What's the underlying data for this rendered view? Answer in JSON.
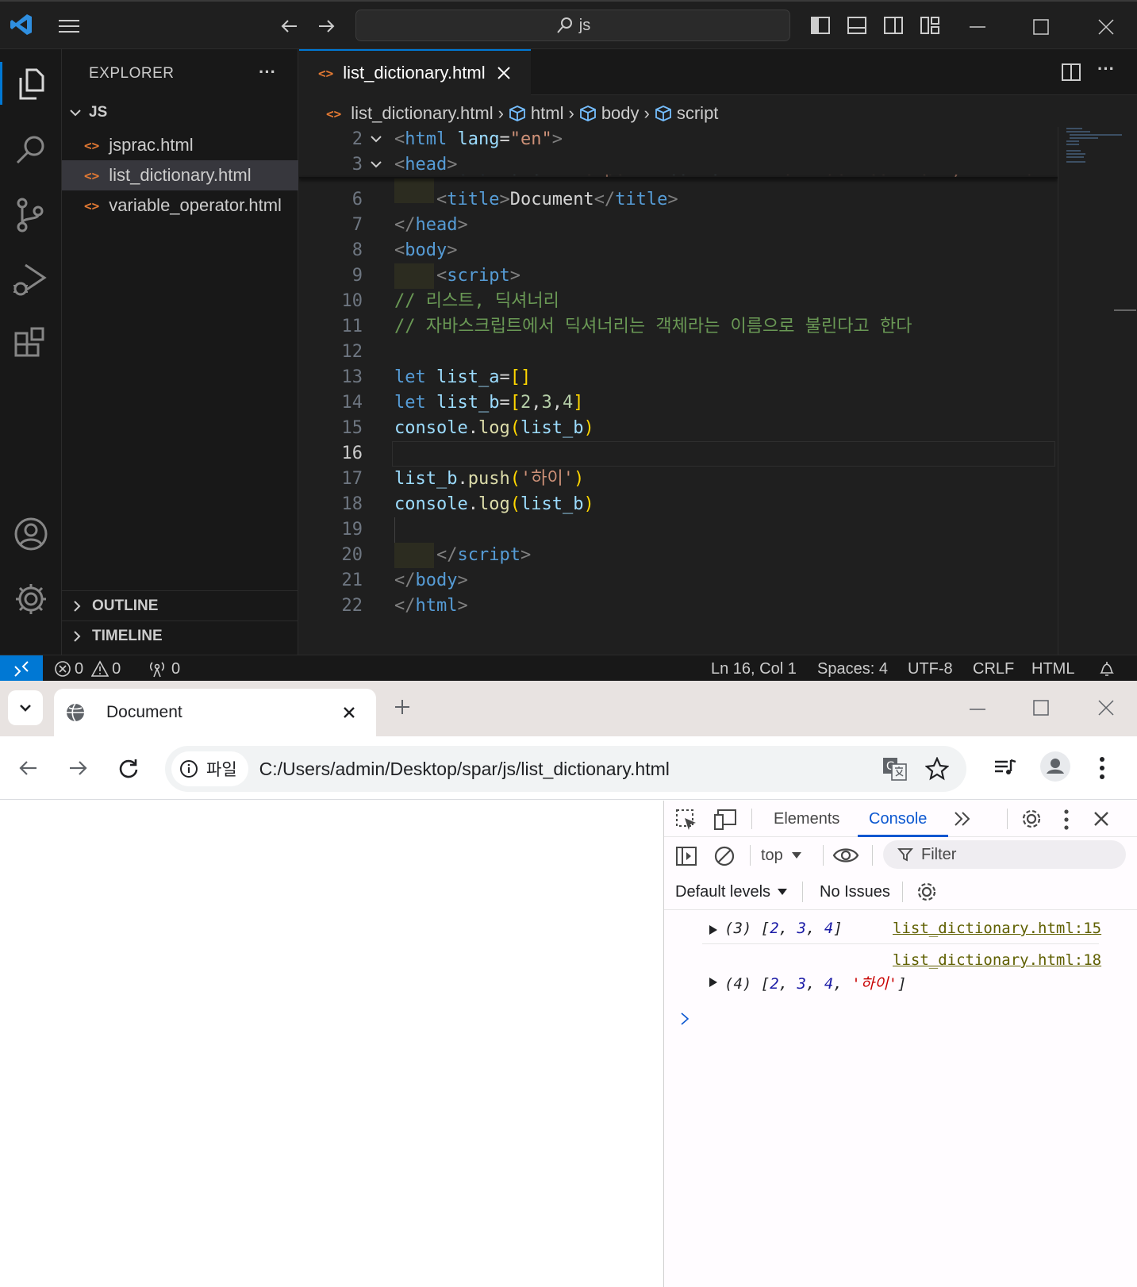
{
  "vscode": {
    "search_text": "js",
    "explorer_title": "EXPLORER",
    "folder": "JS",
    "files": [
      "jsprac.html",
      "list_dictionary.html",
      "variable_operator.html"
    ],
    "outline": "OUTLINE",
    "timeline": "TIMELINE",
    "tab_title": "list_dictionary.html",
    "breadcrumb": [
      "list_dictionary.html",
      "html",
      "body",
      "script"
    ],
    "line_numbers": [
      "2",
      "3",
      "6",
      "7",
      "8",
      "9",
      "10",
      "11",
      "12",
      "13",
      "14",
      "15",
      "16",
      "17",
      "18",
      "19",
      "20",
      "21",
      "22"
    ],
    "current_line": "16",
    "comment_1": "// 리스트, 딕셔너리",
    "comment_2": "// 자바스크립트에서 딕셔너리는 객체라는 이름으로 불린다고 한다",
    "status": {
      "errors": "0",
      "warnings": "0",
      "ports": "0",
      "position": "Ln 16, Col 1",
      "spaces": "Spaces: 4",
      "encoding": "UTF-8",
      "eol": "CRLF",
      "language": "HTML"
    }
  },
  "browser": {
    "tab_title": "Document",
    "site_info": "파일",
    "url": "C:/Users/admin/Desktop/spar/js/list_dictionary.html",
    "devtools": {
      "tabs": [
        "Elements",
        "Console"
      ],
      "context": "top",
      "filter_placeholder": "Filter",
      "levels": "Default levels",
      "issues": "No Issues",
      "log1": {
        "prefix": "(3) [",
        "values": [
          "2",
          "3",
          "4"
        ],
        "suffix": "]",
        "source": "list_dictionary.html:15"
      },
      "log2": {
        "prefix": "(4) [",
        "values": [
          "2",
          "3",
          "4"
        ],
        "string": "'하이'",
        "suffix": "]",
        "source": "list_dictionary.html:18"
      }
    }
  },
  "colors": {
    "vscode_bg": "#1f1f1f",
    "accent_blue": "#0078d4",
    "console_link": "#5f5f00"
  }
}
